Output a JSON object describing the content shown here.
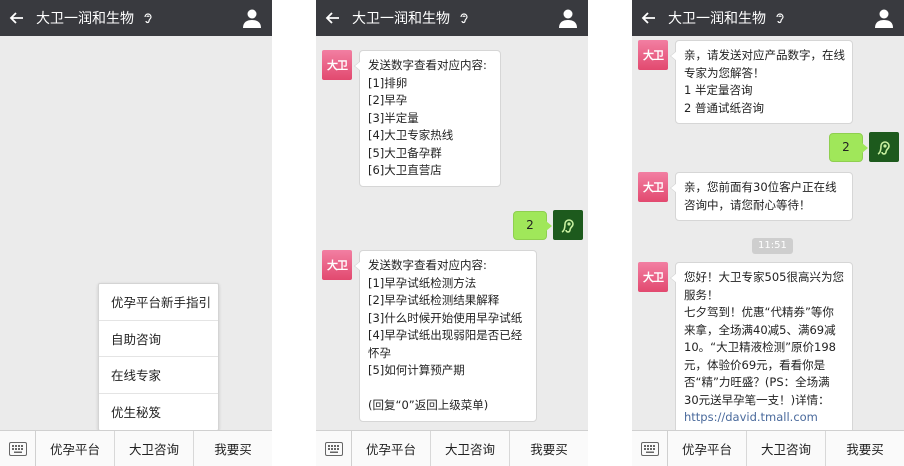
{
  "title": "大卫一润和生物",
  "menu": {
    "item1": "优孕平台",
    "item2": "大卫咨询",
    "item3": "我要买"
  },
  "popup": [
    "优孕平台新手指引",
    "自助咨询",
    "在线专家",
    "优生秘笈"
  ],
  "brand_avatar_text": "大卫",
  "screen2": {
    "msg1": [
      "发送数字查看对应内容:",
      "[1]排卵",
      "[2]早孕",
      "[3]半定量",
      "[4]大卫专家热线",
      "[5]大卫备孕群",
      "[6]大卫直营店"
    ],
    "reply1": "2",
    "msg2": [
      "发送数字查看对应内容:",
      "[1]早孕试纸检测方法",
      "[2]早孕试纸检测结果解释",
      "[3]什么时候开始使用早孕试纸",
      "[4]早孕试纸出现弱阳是否已经",
      "怀孕",
      "[5]如何计算预产期",
      "",
      "(回复“0”返回上级菜单)"
    ]
  },
  "screen3": {
    "msg1": [
      "亲，请发送对应产品数字，在线",
      "专家为您解答！",
      "1  半定量咨询",
      "2  普通试纸咨询"
    ],
    "reply1": "2",
    "msg2": [
      "亲，您前面有30位客户正在线",
      "咨询中，请您耐心等待！"
    ],
    "time": "11:51",
    "msg3": [
      "您好！大卫专家505很高兴为您",
      "服务！",
      "七夕驾到！优惠“代精券”等你",
      "来拿，全场满40减5、满69减",
      "10。“大卫精液检测”原价198",
      "元，体验价69元，看看你是",
      "否“精”力旺盛？(PS：全场满",
      "30元送早孕笔一支！)详情：",
      "https://david.tmall.com"
    ]
  },
  "colors": {
    "topbar": "#393a3f",
    "chat_bg": "#ebebeb",
    "out_bubble": "#a0e75a",
    "brand_pink": "#e2496f",
    "link": "#4a6a9c"
  },
  "icons": [
    "back-arrow-icon",
    "ear-icon",
    "person-icon",
    "keyboard-icon",
    "user-avatar-icon"
  ]
}
